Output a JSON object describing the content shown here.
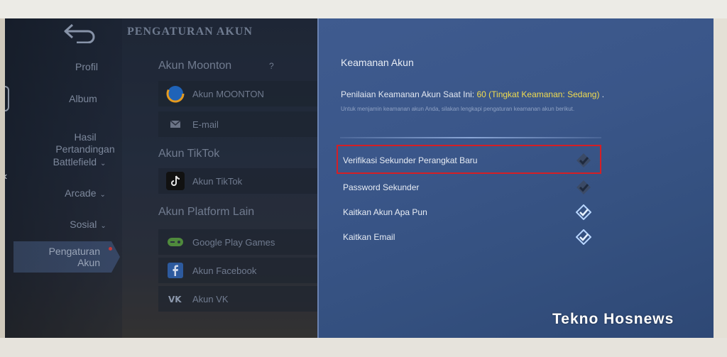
{
  "screen": {
    "title": "PENGATURAN AKUN",
    "back_icon": "back-arrow-icon"
  },
  "nav": {
    "items": [
      {
        "label": "Profil",
        "has_chevron": false
      },
      {
        "label": "Album",
        "has_chevron": false
      },
      {
        "label": "Hasil\nPertandingan",
        "has_chevron": false
      },
      {
        "label": "Battlefield",
        "has_chevron": true
      },
      {
        "label": "Arcade",
        "has_chevron": true
      },
      {
        "label": "Sosial",
        "has_chevron": true
      }
    ],
    "active": {
      "label": "Pengaturan\nAkun",
      "has_notification_dot": true
    }
  },
  "accounts": {
    "moonton": {
      "heading": "Akun Moonton",
      "help": "?",
      "rows": [
        {
          "label": "Akun MOONTON",
          "icon": "moonton-logo-icon"
        },
        {
          "label": "E-mail",
          "icon": "mail-icon"
        }
      ]
    },
    "tiktok": {
      "heading": "Akun TikTok",
      "rows": [
        {
          "label": "Akun TikTok",
          "icon": "tiktok-logo-icon"
        }
      ]
    },
    "other": {
      "heading": "Akun Platform Lain",
      "rows": [
        {
          "label": "Google Play Games",
          "icon": "gamepad-icon"
        },
        {
          "label": "Akun Facebook",
          "icon": "facebook-icon"
        },
        {
          "label": "Akun VK",
          "icon": "vk-icon"
        }
      ]
    }
  },
  "security": {
    "title": "Keamanan Akun",
    "score_prefix": "Penilaian Keamanan Akun Saat Ini: ",
    "score_value": "60 (Tingkat Keamanan: Sedang)",
    "score_suffix": " .",
    "hint": "Untuk menjamin keamanan akun Anda, silakan lengkapi pengaturan keamanan akun berikut.",
    "options": [
      {
        "label": "Verifikasi Sekunder Perangkat Baru",
        "status": "incomplete",
        "highlighted": true
      },
      {
        "label": "Password Sekunder",
        "status": "incomplete",
        "highlighted": false
      },
      {
        "label": "Kaitkan Akun Apa Pun",
        "status": "complete",
        "highlighted": false
      },
      {
        "label": "Kaitkan Email",
        "status": "complete",
        "highlighted": false
      }
    ]
  },
  "colors": {
    "score_highlight": "#f1dc4f",
    "highlight_border": "#d51f25",
    "panel_bg": "#3a5689"
  },
  "watermark": "Tekno Hosnews"
}
